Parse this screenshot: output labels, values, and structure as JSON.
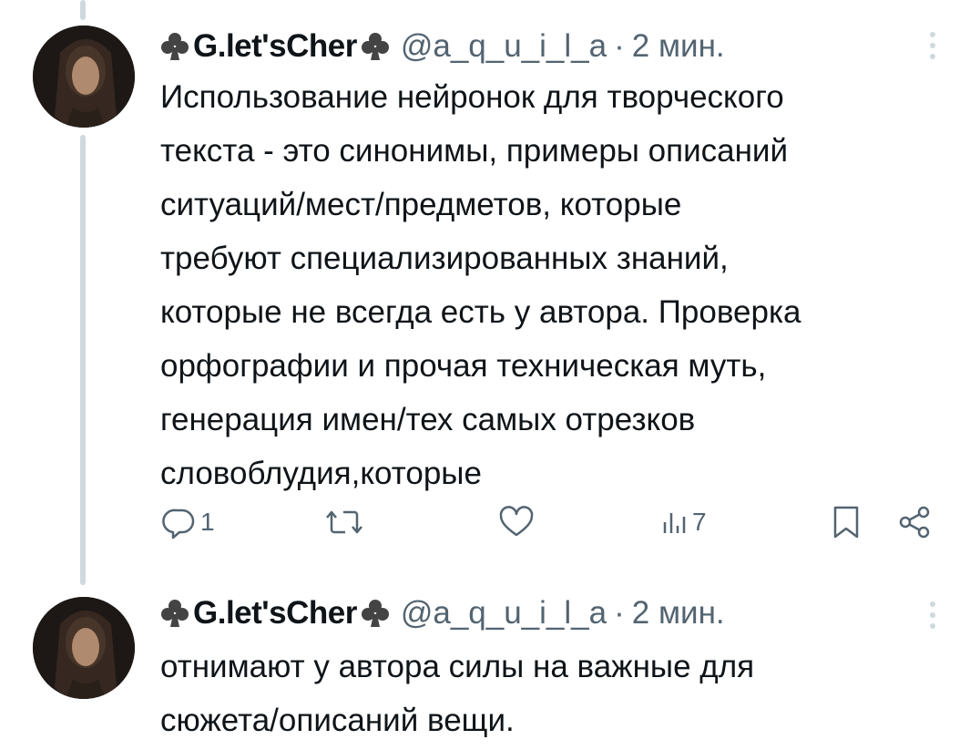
{
  "tweets": [
    {
      "display_name": "G.let'sCher",
      "handle": "@a_q_u_i_l_a",
      "separator": "·",
      "time": "2 мин.",
      "text": "Использование нейронок для творческого\nтекста - это синонимы, примеры описаний\nситуаций/мест/предметов, которые\nтребуют специализированных знаний,\nкоторые не всегда есть у автора. Проверка\nорфографии и прочая техническая муть,\nгенерация имен/тех самых отрезков\nсловоблудия,которые",
      "actions": {
        "reply_count": "1",
        "retweet_count": "",
        "like_count": "",
        "views_count": "7"
      }
    },
    {
      "display_name": "G.let'sCher",
      "handle": "@a_q_u_i_l_a",
      "separator": "·",
      "time": "2 мин.",
      "text": "отнимают у автора силы на важные для\nсюжета/описаний вещи."
    }
  ],
  "icons": {
    "name_decoration": "club-suit-icon",
    "more": "more-vertical-icon",
    "reply": "reply-icon",
    "retweet": "retweet-icon",
    "like": "heart-icon",
    "views": "views-icon",
    "bookmark": "bookmark-icon",
    "share": "share-icon"
  },
  "colors": {
    "text": "#0f1419",
    "secondary": "#536471",
    "thread_line": "#cfd9de",
    "background": "#ffffff"
  }
}
